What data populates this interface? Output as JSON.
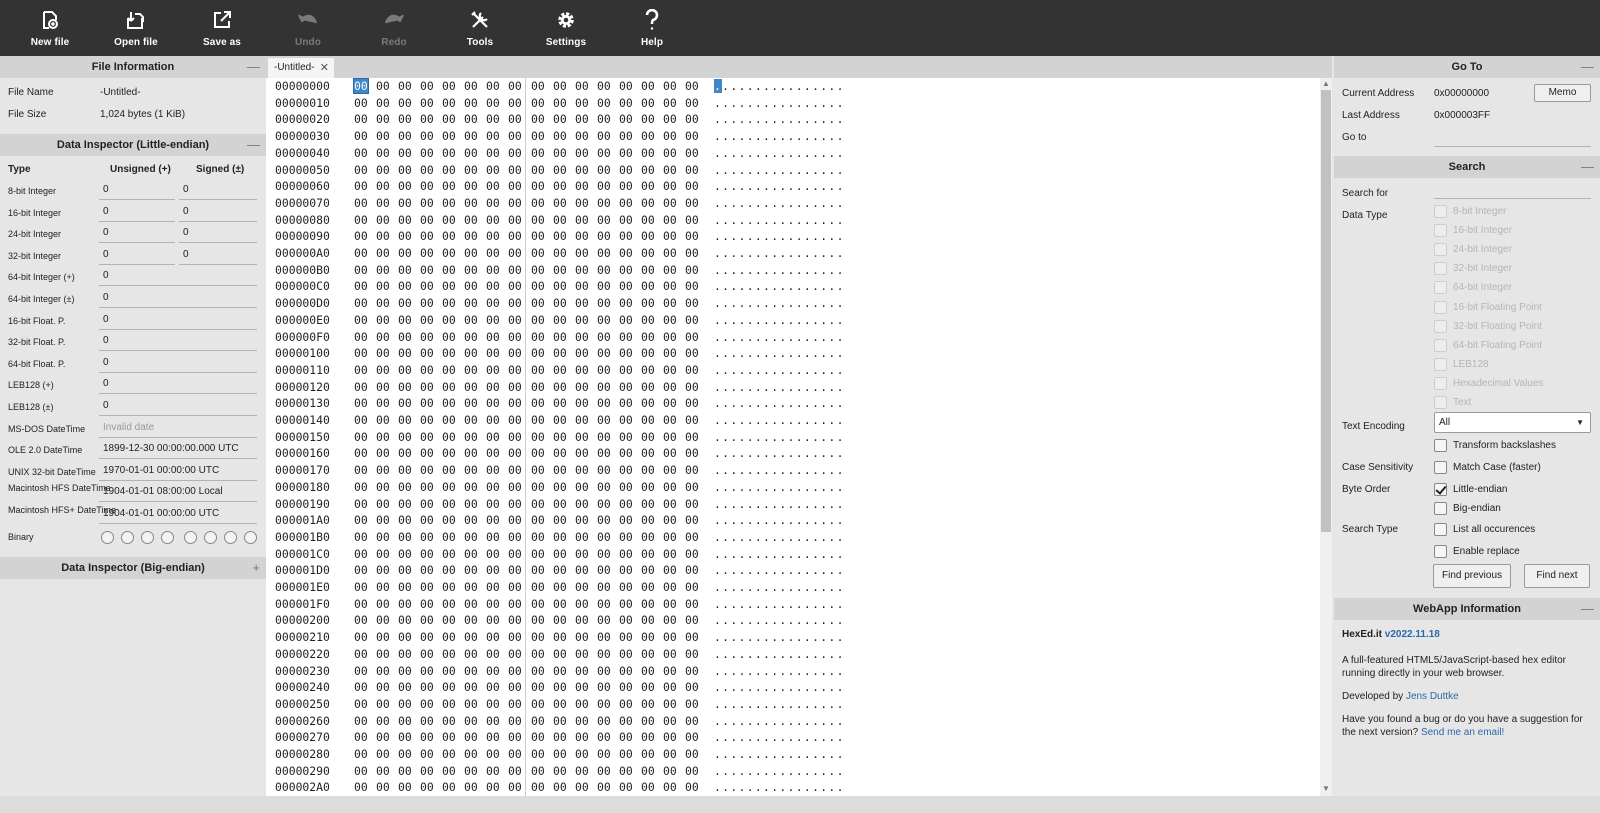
{
  "toolbar": {
    "buttons": [
      {
        "label": "New file",
        "icon": "new-file-icon",
        "disabled": false
      },
      {
        "label": "Open file",
        "icon": "open-file-icon",
        "disabled": false
      },
      {
        "label": "Save as",
        "icon": "save-as-icon",
        "disabled": false
      },
      {
        "label": "Undo",
        "icon": "undo-icon",
        "disabled": true
      },
      {
        "label": "Redo",
        "icon": "redo-icon",
        "disabled": true
      },
      {
        "label": "Tools",
        "icon": "tools-icon",
        "disabled": false
      },
      {
        "label": "Settings",
        "icon": "gear-icon",
        "disabled": false
      },
      {
        "label": "Help",
        "icon": "help-icon",
        "disabled": false
      }
    ]
  },
  "file_info": {
    "title": "File Information",
    "name_label": "File Name",
    "name_value": "-Untitled-",
    "size_label": "File Size",
    "size_value": "1,024 bytes (1 KiB)"
  },
  "inspector_le": {
    "title": "Data Inspector (Little-endian)",
    "col_type": "Type",
    "col_unsigned": "Unsigned (+)",
    "col_signed": "Signed (±)",
    "rows": [
      {
        "type": "8-bit Integer",
        "unsigned": "0",
        "signed": "0"
      },
      {
        "type": "16-bit Integer",
        "unsigned": "0",
        "signed": "0"
      },
      {
        "type": "24-bit Integer",
        "unsigned": "0",
        "signed": "0"
      },
      {
        "type": "32-bit Integer",
        "unsigned": "0",
        "signed": "0"
      },
      {
        "type": "64-bit Integer (+)",
        "value": "0"
      },
      {
        "type": "64-bit Integer (±)",
        "value": "0"
      },
      {
        "type": "16-bit Float. P.",
        "value": "0"
      },
      {
        "type": "32-bit Float. P.",
        "value": "0"
      },
      {
        "type": "64-bit Float. P.",
        "value": "0"
      },
      {
        "type": "LEB128 (+)",
        "value": "0"
      },
      {
        "type": "LEB128 (±)",
        "value": "0"
      },
      {
        "type": "MS-DOS DateTime",
        "placeholder": "Invalid date"
      },
      {
        "type": "OLE 2.0 DateTime",
        "value": "1899-12-30 00:00:00.000 UTC"
      },
      {
        "type": "UNIX 32-bit DateTime",
        "value": "1970-01-01 00:00:00 UTC"
      },
      {
        "type": "Macintosh HFS DateTime",
        "value": "1904-01-01 08:00:00 Local"
      },
      {
        "type": "Macintosh HFS+ DateTime",
        "value": "1904-01-01 00:00:00 UTC"
      }
    ],
    "binary_label": "Binary"
  },
  "inspector_be": {
    "title": "Data Inspector (Big-endian)"
  },
  "editor": {
    "tab_label": "-Untitled-",
    "selected_byte": "00",
    "byte_value": "00",
    "ascii_char": ".",
    "addresses": [
      "00000000",
      "00000010",
      "00000020",
      "00000030",
      "00000040",
      "00000050",
      "00000060",
      "00000070",
      "00000080",
      "00000090",
      "000000A0",
      "000000B0",
      "000000C0",
      "000000D0",
      "000000E0",
      "000000F0",
      "00000100",
      "00000110",
      "00000120",
      "00000130",
      "00000140",
      "00000150",
      "00000160",
      "00000170",
      "00000180",
      "00000190",
      "000001A0",
      "000001B0",
      "000001C0",
      "000001D0",
      "000001E0",
      "000001F0",
      "00000200",
      "00000210",
      "00000220",
      "00000230",
      "00000240",
      "00000250",
      "00000260",
      "00000270",
      "00000280",
      "00000290",
      "000002A0"
    ]
  },
  "goto": {
    "title": "Go To",
    "current_label": "Current Address",
    "current_value": "0x00000000",
    "memo_label": "Memo",
    "last_label": "Last Address",
    "last_value": "0x000003FF",
    "goto_label": "Go to"
  },
  "search": {
    "title": "Search",
    "search_for_label": "Search for",
    "data_type_label": "Data Type",
    "data_types": [
      "8-bit Integer",
      "16-bit Integer",
      "24-bit Integer",
      "32-bit Integer",
      "64-bit Integer",
      "16-bit Floating Point",
      "32-bit Floating Point",
      "64-bit Floating Point",
      "LEB128",
      "Hexadecimal Values",
      "Text"
    ],
    "text_encoding_label": "Text Encoding",
    "text_encoding_value": "All",
    "transform_label": "Transform backslashes",
    "case_label": "Case Sensitivity",
    "match_case_label": "Match Case (faster)",
    "byte_order_label": "Byte Order",
    "little_endian_label": "Little-endian",
    "big_endian_label": "Big-endian",
    "search_type_label": "Search Type",
    "list_all_label": "List all occurences",
    "enable_replace_label": "Enable replace",
    "find_prev_label": "Find previous",
    "find_next_label": "Find next"
  },
  "webapp": {
    "title": "WebApp Information",
    "app_name": "HexEd.it",
    "version": "v2022.11.18",
    "desc": "A full-featured HTML5/JavaScript-based hex editor running directly in your web browser.",
    "dev_prefix": "Developed by",
    "dev_name": "Jens Duttke",
    "bug_text": "Have you found a bug or do you have a suggestion for the next version?",
    "email_link": "Send me an email!"
  },
  "colors": {
    "toolbar_bg": "#333333",
    "selection": "#3f88c5",
    "link": "#2a6aa8"
  }
}
